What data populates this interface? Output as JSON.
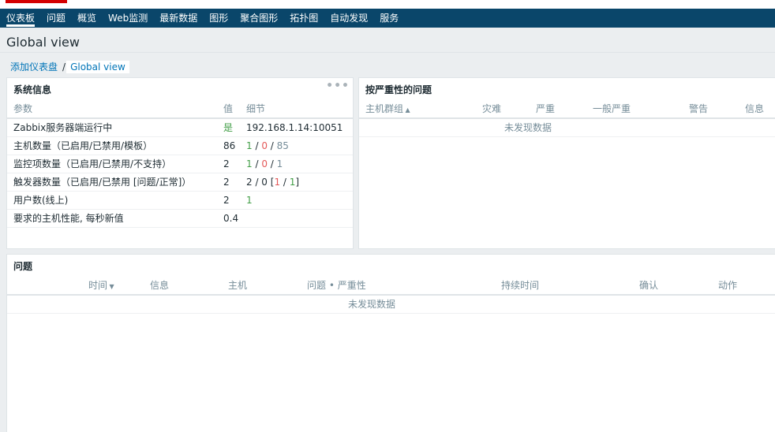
{
  "nav": {
    "items": [
      {
        "label": "仪表板",
        "active": true
      },
      {
        "label": "问题"
      },
      {
        "label": "概览"
      },
      {
        "label": "Web监测"
      },
      {
        "label": "最新数据"
      },
      {
        "label": "图形"
      },
      {
        "label": "聚合图形"
      },
      {
        "label": "拓扑图"
      },
      {
        "label": "自动发现"
      },
      {
        "label": "服务"
      }
    ]
  },
  "page": {
    "title": "Global view"
  },
  "breadcrumb": {
    "parent": "添加仪表盘",
    "separator": "/",
    "current": "Global view"
  },
  "sysinfo": {
    "title": "系统信息",
    "more": "•••",
    "headers": {
      "param": "参数",
      "value": "值",
      "detail": "细节"
    },
    "rows": [
      {
        "param": "Zabbix服务器端运行中",
        "value": "是",
        "detail": "192.168.1.14:10051"
      },
      {
        "param": "主机数量（已启用/已禁用/模板）",
        "value": "86",
        "d1": "1",
        "s1": " / ",
        "d2": "0",
        "s2": " / ",
        "d3": "85"
      },
      {
        "param": "监控项数量（已启用/已禁用/不支持）",
        "value": "2",
        "d1": "1",
        "s1": " / ",
        "d2": "0",
        "s2": " / ",
        "d3": "1"
      },
      {
        "param": "触发器数量（已启用/已禁用 [问题/正常]）",
        "value": "2",
        "t1": "2 / 0 [",
        "t2": "1",
        "t3": " / ",
        "t4": "1",
        "t5": "]"
      },
      {
        "param": "用户数(线上)",
        "value": "2",
        "d1": "1"
      },
      {
        "param": "要求的主机性能, 每秒新值",
        "value": "0.4"
      }
    ]
  },
  "severity": {
    "title": "按严重性的问题",
    "headers": {
      "hostgroup": "主机群组",
      "disaster": "灾难",
      "high": "严重",
      "average": "一般严重",
      "warning": "警告",
      "info": "信息"
    },
    "nodata": "未发现数据"
  },
  "problems": {
    "title": "问题",
    "headers": {
      "time": "时间",
      "info": "信息",
      "host": "主机",
      "problem": "问题 • 严重性",
      "duration": "持续时间",
      "ack": "确认",
      "actions": "动作"
    },
    "nodata": "未发现数据"
  },
  "colors": {
    "nav_bg": "#0a466a",
    "link": "#0275b8",
    "green": "#429e47",
    "red": "#e45959",
    "logo_red": "#d40000"
  }
}
